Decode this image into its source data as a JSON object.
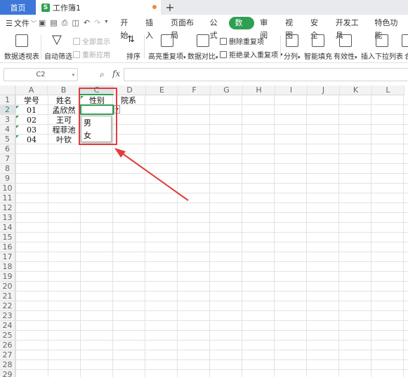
{
  "tabs": {
    "home": "首页",
    "doc_logo": "S",
    "doc": "工作簿1",
    "add": "+"
  },
  "menu": {
    "file": "文件",
    "items": [
      "开始",
      "插入",
      "页面布局",
      "公式",
      "数据",
      "审阅",
      "视图",
      "安全",
      "开发工具",
      "特色功能"
    ],
    "active": "数据"
  },
  "ribbon": {
    "pivot": "数据透视表",
    "autofilter": "自动筛选",
    "show_all": "全部显示",
    "reapply": "重新应用",
    "sort": "排序",
    "highlight_dup": "高亮重复项",
    "compare": "数据对比",
    "remove_dup": "删除重复项",
    "reject_dup": "拒绝录入重复项",
    "split": "分列",
    "smart_fill": "智能填充",
    "validity": "有效性",
    "insert_dropdown": "插入下拉列表",
    "merge": "合"
  },
  "formula_bar": {
    "name_box": "C2",
    "fx": "fx",
    "formula": ""
  },
  "columns": [
    "A",
    "B",
    "C",
    "D",
    "E",
    "F",
    "G",
    "H",
    "I",
    "J",
    "K",
    "L"
  ],
  "selected_column": "C",
  "rows": [
    "1",
    "2",
    "3",
    "4",
    "5",
    "6",
    "7",
    "8",
    "9",
    "10",
    "11",
    "12",
    "13",
    "14",
    "15",
    "16",
    "17",
    "18",
    "19",
    "20",
    "21",
    "22",
    "23",
    "24",
    "25",
    "26",
    "27",
    "28",
    "29"
  ],
  "selected_row": "2",
  "header_row": {
    "A": "学号",
    "B": "姓名",
    "C": "性别",
    "D": "院系"
  },
  "data_rows": [
    {
      "id": "01",
      "name": "孟欣然"
    },
    {
      "id": "02",
      "name": "王可"
    },
    {
      "id": "03",
      "name": "程菲池"
    },
    {
      "id": "04",
      "name": "叶钦"
    }
  ],
  "dropdown_options": [
    "男",
    "女"
  ],
  "colors": {
    "accent": "#2fa052",
    "home_tab": "#3d77d8",
    "highlight": "#e23c3c"
  }
}
